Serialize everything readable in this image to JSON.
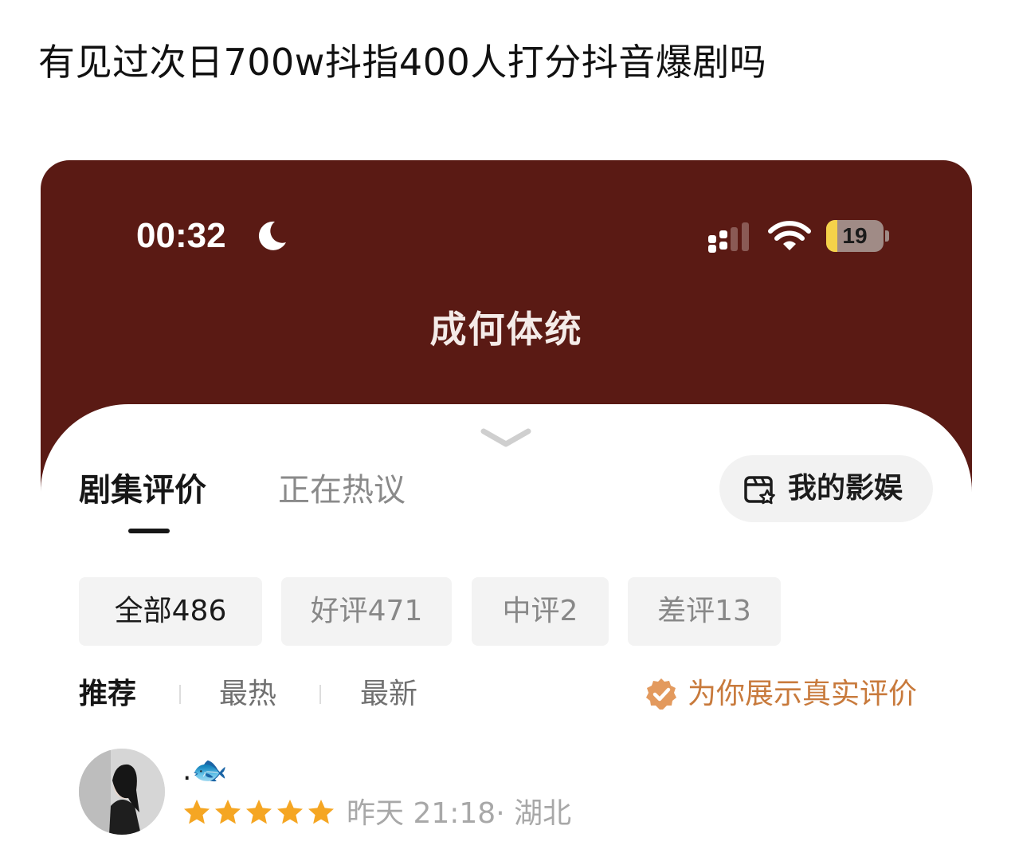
{
  "post": {
    "title": "有见过次日700w抖指400人打分抖音爆剧吗"
  },
  "status_bar": {
    "time": "00:32",
    "battery": "19",
    "battery_level": 0.19,
    "icons": [
      "moon-icon",
      "signal-icon",
      "wifi-icon",
      "battery-icon"
    ]
  },
  "drama": {
    "title": "成何体统"
  },
  "colors": {
    "header_background": "#5a1a14",
    "accent_orange": "#c87a3c",
    "star": "#f5a623",
    "chip_background": "#f3f3f3"
  },
  "tabs": {
    "active": "剧集评价",
    "inactive": "正在热议"
  },
  "my_entertainment": {
    "label": "我的影娱",
    "icon": "film-star-icon"
  },
  "filters": {
    "all": "全部486",
    "good": "好评471",
    "mid": "中评2",
    "bad": "差评13",
    "selected": "全部486"
  },
  "sort": {
    "recommended": "推荐",
    "hot": "最热",
    "new": "最新",
    "selected": "推荐"
  },
  "authentic_badge": {
    "text": "为你展示真实评价",
    "icon": "shield-check-icon"
  },
  "review": {
    "name": ".🐟",
    "rating": 5,
    "meta": "昨天 21:18· 湖北"
  }
}
